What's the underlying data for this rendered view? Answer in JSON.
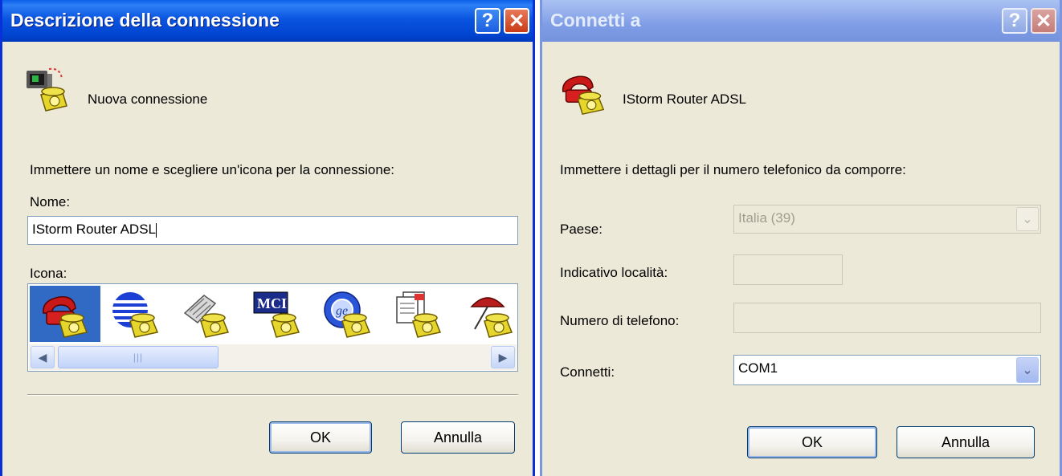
{
  "left_dialog": {
    "title": "Descrizione della connessione",
    "help_glyph": "?",
    "close_glyph": "✕",
    "header_icon": "computer-phone-icon",
    "header_label": "Nuova connessione",
    "instruction": "Immettere un nome e scegliere un'icona per la connessione:",
    "name_label": "Nome:",
    "name_value": "IStorm Router ADSL",
    "icon_label": "Icona:",
    "icons": [
      "red-telephone-icon",
      "globe-phone-icon",
      "fax-phone-icon",
      "mci-phone-icon",
      "ge-globe-phone-icon",
      "documents-phone-icon",
      "umbrella-phone-icon"
    ],
    "selected_icon_index": 0,
    "ok_label": "OK",
    "cancel_label": "Annulla"
  },
  "right_dialog": {
    "title": "Connetti a",
    "help_glyph": "?",
    "close_glyph": "✕",
    "header_icon": "red-telephone-icon",
    "header_label": "IStorm Router ADSL",
    "instruction": "Immettere i dettagli per il numero telefonico da comporre:",
    "country_label": "Paese:",
    "country_value": "Italia (39)",
    "area_code_label": "Indicativo località:",
    "area_code_value": "",
    "phone_label": "Numero di telefono:",
    "phone_value": "",
    "connect_label": "Connetti:",
    "connect_value": "COM1",
    "ok_label": "OK",
    "cancel_label": "Annulla"
  },
  "colors": {
    "active_titlebar": "#0a55e0",
    "inactive_titlebar": "#7f9de6",
    "dialog_face": "#ece9d8",
    "selection": "#316ac5"
  }
}
